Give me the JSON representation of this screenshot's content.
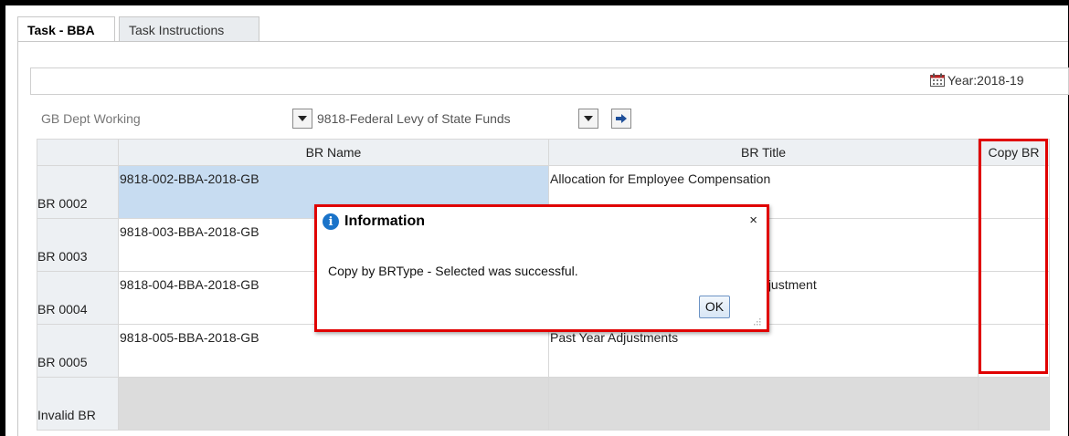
{
  "tabs": [
    {
      "label": "Task - BBA",
      "active": true
    },
    {
      "label": "Task Instructions",
      "active": false
    }
  ],
  "year": {
    "icon": "calendar-icon",
    "label": "Year:2018-19"
  },
  "pov": {
    "dept": "GB Dept Working",
    "fund": "9818-Federal Levy of State Funds"
  },
  "grid": {
    "headers": [
      "",
      "BR Name",
      "BR Title",
      "Copy BR"
    ],
    "rows": [
      {
        "label": "BR 0002",
        "name": "9818-002-BBA-2018-GB",
        "title": "Allocation for Employee Compensation",
        "copy": ""
      },
      {
        "label": "BR 0003",
        "name": "9818-003-BBA-2018-GB",
        "title": "",
        "copy": ""
      },
      {
        "label": "BR 0004",
        "name": "9818-004-BBA-2018-GB",
        "title": "on Adjustment",
        "copy": ""
      },
      {
        "label": "BR 0005",
        "name": "9818-005-BBA-2018-GB",
        "title": "Past Year Adjustments",
        "copy": ""
      },
      {
        "label": "Invalid BR",
        "name": "",
        "title": "",
        "copy": ""
      }
    ]
  },
  "dialog": {
    "title": "Information",
    "icon": "info-icon",
    "close": "×",
    "message": "Copy by BRType - Selected was successful.",
    "ok": "OK"
  },
  "colors": {
    "highlight": "#e00000",
    "selected": "#c7dcf1",
    "info": "#1a73c9"
  }
}
